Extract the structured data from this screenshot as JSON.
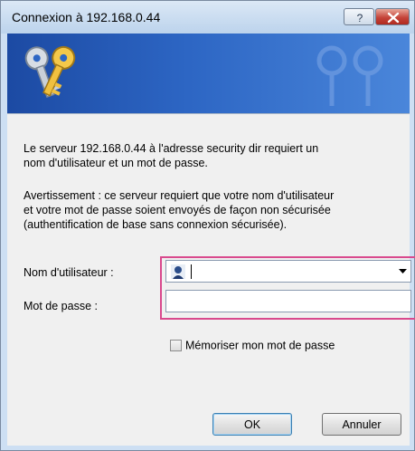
{
  "window": {
    "title": "Connexion à 192.168.0.44",
    "help_button": "?",
    "close_button": "✕"
  },
  "message": {
    "line1": "Le serveur 192.168.0.44 à l'adresse security dir requiert un",
    "line2": "nom d'utilisateur et un mot de passe.",
    "warning_line1": "Avertissement : ce serveur requiert que votre nom d'utilisateur",
    "warning_line2": "et votre mot de passe soient envoyés de façon non sécurisée",
    "warning_line3": "(authentification de base sans connexion sécurisée)."
  },
  "form": {
    "username_label": "Nom d'utilisateur :",
    "username_value": "",
    "password_label": "Mot de passe :",
    "password_value": "",
    "remember_label": "Mémoriser mon mot de passe",
    "remember_checked": false
  },
  "buttons": {
    "ok": "OK",
    "cancel": "Annuler"
  },
  "colors": {
    "highlight": "#d9498d",
    "banner": "#2d66c4"
  },
  "icons": {
    "banner": "keys-icon",
    "user": "user-icon",
    "dropdown": "chevron-down-icon"
  }
}
